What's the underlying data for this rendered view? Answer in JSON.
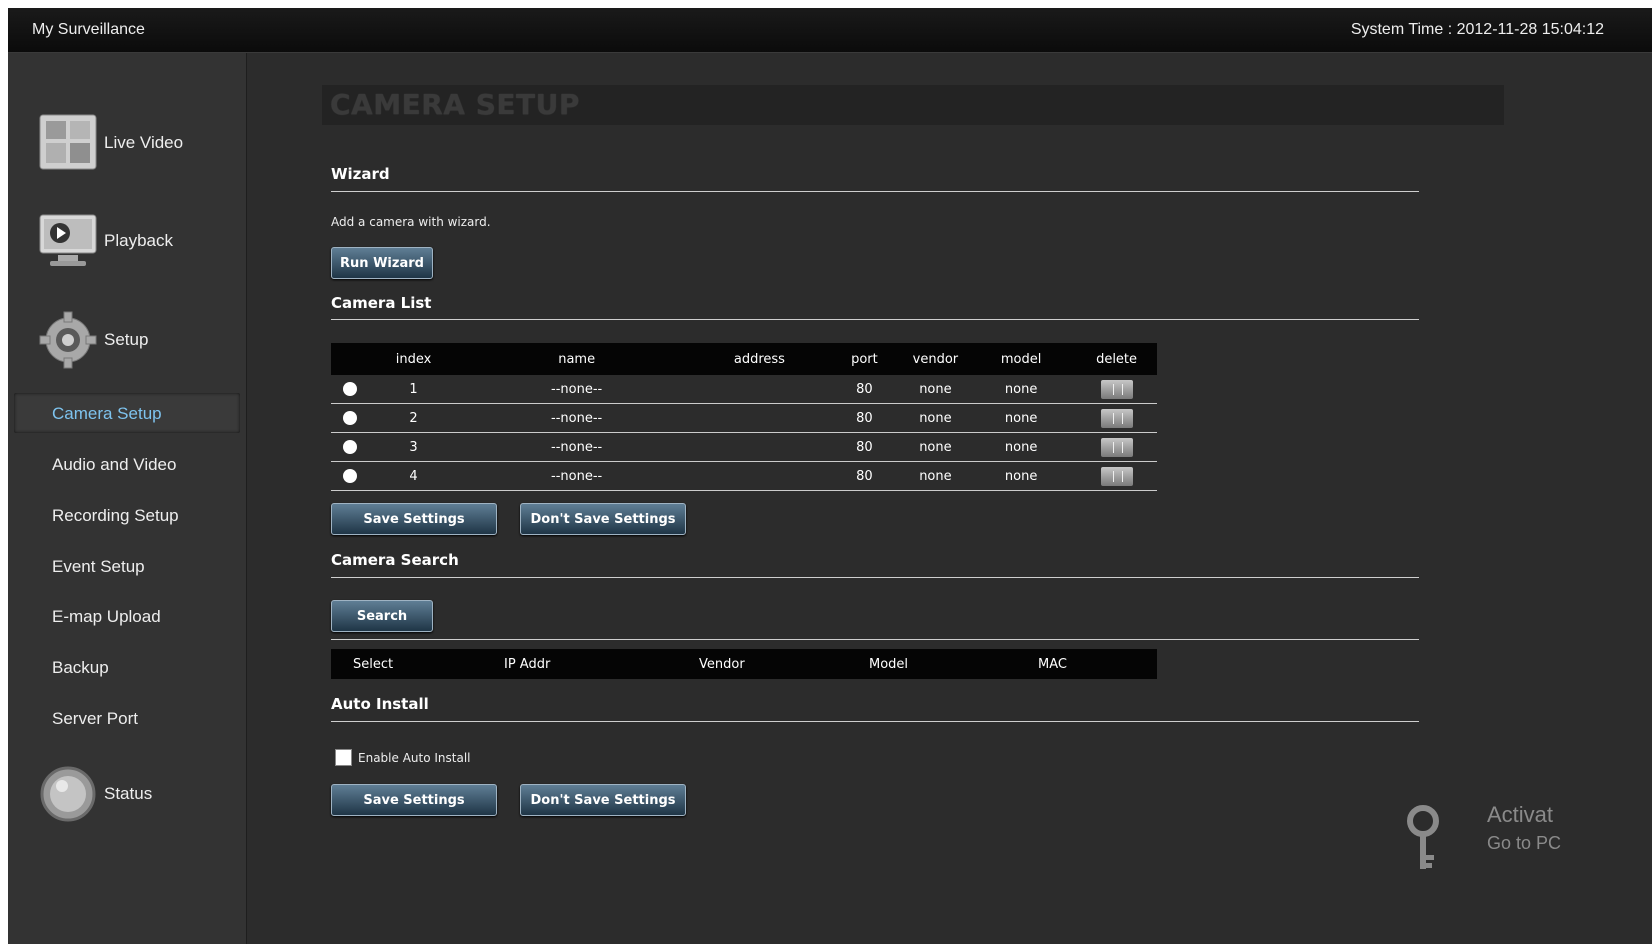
{
  "topbar": {
    "app_title": "My Surveillance",
    "system_time": "System Time : 2012-11-28 15:04:12"
  },
  "sidebar": {
    "main_items": [
      {
        "label": "Live Video",
        "icon": "live-video-icon"
      },
      {
        "label": "Playback",
        "icon": "playback-icon"
      },
      {
        "label": "Setup",
        "icon": "setup-gear-icon"
      },
      {
        "label": "Status",
        "icon": "status-icon"
      }
    ],
    "sub_items": [
      "Camera Setup",
      "Audio and Video",
      "Recording Setup",
      "Event Setup",
      "E-map Upload",
      "Backup",
      "Server Port"
    ],
    "active_sub": "Camera Setup"
  },
  "page": {
    "title": "CAMERA SETUP"
  },
  "wizard": {
    "heading": "Wizard",
    "description": "Add a camera with wizard.",
    "button": "Run Wizard"
  },
  "camera_list": {
    "heading": "Camera List",
    "columns": [
      "index",
      "name",
      "address",
      "port",
      "vendor",
      "model",
      "delete"
    ],
    "rows": [
      {
        "index": "1",
        "name": "--none--",
        "address": "",
        "port": "80",
        "vendor": "none",
        "model": "none"
      },
      {
        "index": "2",
        "name": "--none--",
        "address": "",
        "port": "80",
        "vendor": "none",
        "model": "none"
      },
      {
        "index": "3",
        "name": "--none--",
        "address": "",
        "port": "80",
        "vendor": "none",
        "model": "none"
      },
      {
        "index": "4",
        "name": "--none--",
        "address": "",
        "port": "80",
        "vendor": "none",
        "model": "none"
      }
    ],
    "save_button": "Save Settings",
    "dont_save_button": "Don't Save Settings"
  },
  "camera_search": {
    "heading": "Camera Search",
    "button": "Search",
    "columns": [
      "Select",
      "IP Addr",
      "Vendor",
      "Model",
      "MAC"
    ]
  },
  "auto_install": {
    "heading": "Auto Install",
    "checkbox_label": "Enable Auto Install",
    "checked": false,
    "save_button": "Save Settings",
    "dont_save_button": "Don't Save Settings"
  },
  "watermark": {
    "line1": "Activat",
    "line2": "Go to PC"
  }
}
